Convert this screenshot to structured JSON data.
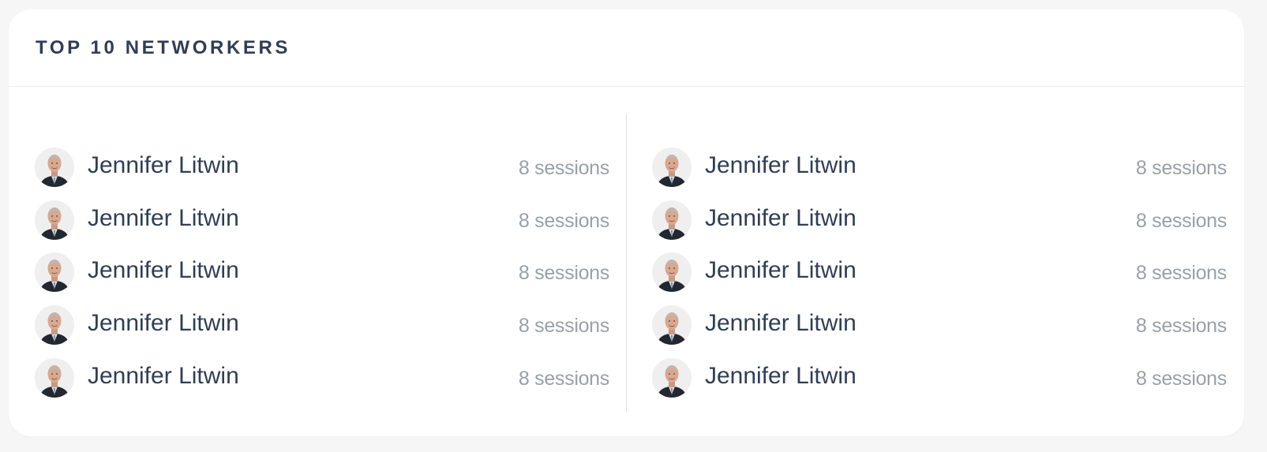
{
  "card": {
    "title": "TOP 10 NETWORKERS"
  },
  "networkers_left": [
    {
      "name": "Jennifer Litwin",
      "sessions": "8 sessions"
    },
    {
      "name": "Jennifer Litwin",
      "sessions": "8 sessions"
    },
    {
      "name": "Jennifer Litwin",
      "sessions": "8 sessions"
    },
    {
      "name": "Jennifer Litwin",
      "sessions": "8 sessions"
    },
    {
      "name": "Jennifer Litwin",
      "sessions": "8 sessions"
    }
  ],
  "networkers_right": [
    {
      "name": "Jennifer Litwin",
      "sessions": "8 sessions"
    },
    {
      "name": "Jennifer Litwin",
      "sessions": "8 sessions"
    },
    {
      "name": "Jennifer Litwin",
      "sessions": "8 sessions"
    },
    {
      "name": "Jennifer Litwin",
      "sessions": "8 sessions"
    },
    {
      "name": "Jennifer Litwin",
      "sessions": "8 sessions"
    }
  ],
  "colors": {
    "title": "#2f3e55",
    "name": "#2f3e55",
    "sessions": "#9aa0a8",
    "divider": "#dcdfe3"
  },
  "icons": {
    "avatar": "person-portrait-avatar"
  }
}
